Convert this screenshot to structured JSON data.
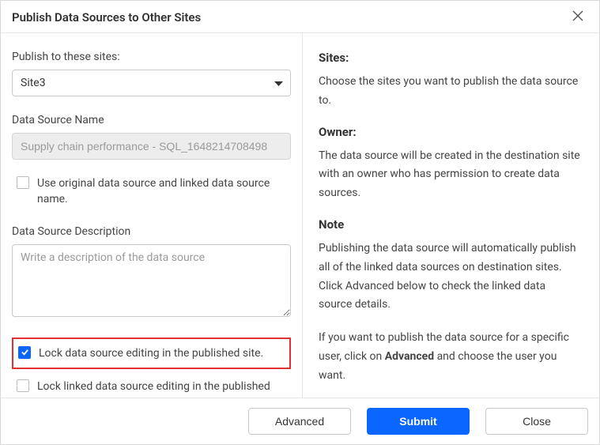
{
  "dialog": {
    "title": "Publish Data Sources to Other Sites"
  },
  "form": {
    "sitesLabel": "Publish to these sites:",
    "siteSelected": "Site3",
    "dsNameLabel": "Data Source Name",
    "dsNameValue": "Supply chain performance - SQL_1648214708498",
    "useOriginalLabel": "Use original data source and linked data source name.",
    "dsDescLabel": "Data Source Description",
    "dsDescPlaceholder": "Write a description of the data source",
    "lockEditLabel": "Lock data source editing in the published site.",
    "lockLinkedLabel": "Lock linked data source editing in the published site."
  },
  "info": {
    "sitesHeading": "Sites:",
    "sitesBody": "Choose the sites you want to publish the data source to.",
    "ownerHeading": "Owner:",
    "ownerBody": "The data source will be created in the destination site with an owner who has permission to create data sources.",
    "noteHeading": "Note",
    "noteBody1": "Publishing the data source will automatically publish all of the linked data sources on destination sites. Click Advanced below to check the linked data source details.",
    "noteBody2a": "If you want to publish the data source for a specific user, click on ",
    "noteBody2bold": "Advanced",
    "noteBody2b": " and choose the user you want."
  },
  "footer": {
    "advanced": "Advanced",
    "submit": "Submit",
    "close": "Close"
  }
}
